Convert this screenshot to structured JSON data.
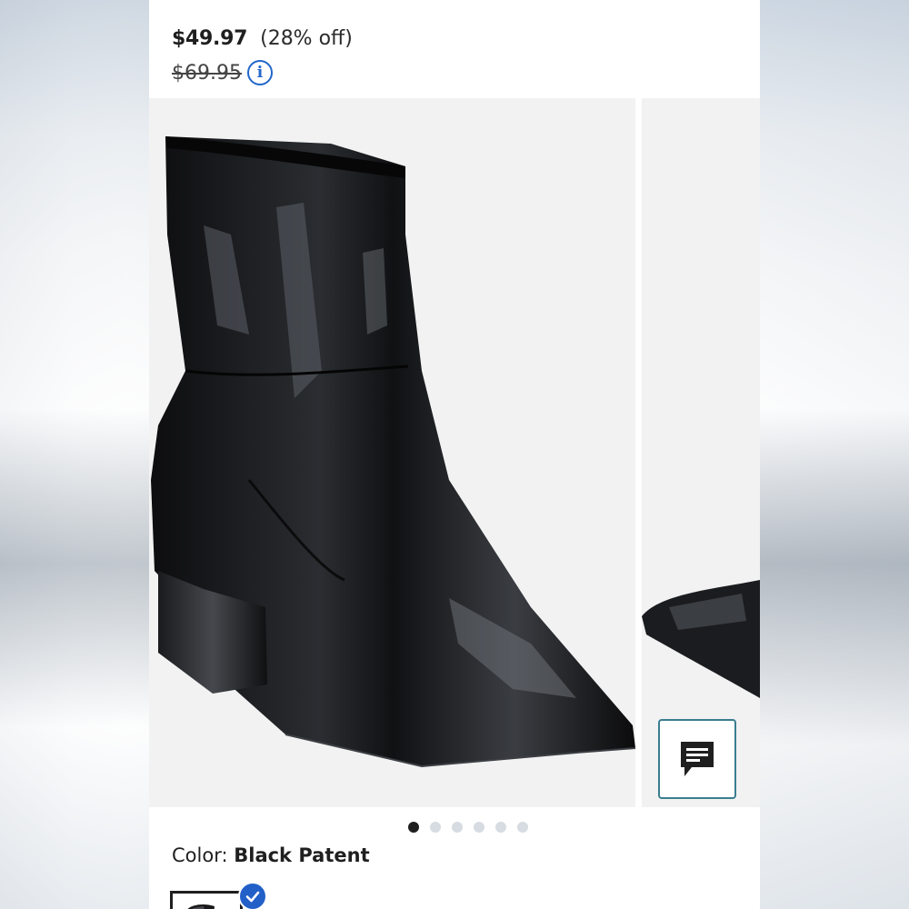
{
  "product": {
    "sale_price": "$49.97",
    "discount": "(28% off)",
    "original_price": "$69.95"
  },
  "gallery": {
    "image_count": 6,
    "active_index": 0
  },
  "color": {
    "label": "Color:",
    "value": "Black Patent"
  },
  "icons": {
    "info": "info-icon",
    "chat": "chat-icon",
    "check": "check-icon"
  },
  "colors": {
    "accent_blue": "#2267c9",
    "chat_border": "#3a7d8f",
    "text": "#1f1f1f"
  }
}
